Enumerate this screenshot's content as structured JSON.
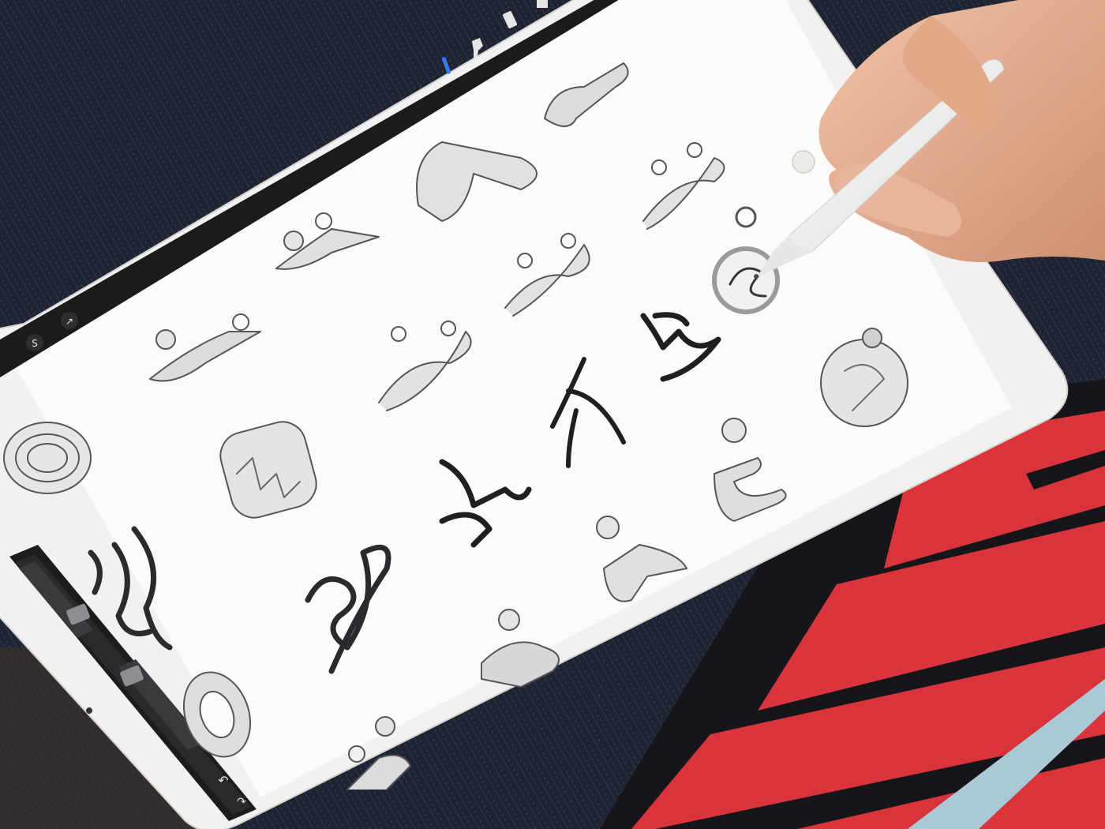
{
  "toolbar": {
    "left_buttons": [
      {
        "label": "S",
        "icon": "selection-icon"
      },
      {
        "label": "↗",
        "icon": "transform-arrow-icon"
      }
    ],
    "top_tools": [
      {
        "icon": "brush-icon",
        "active": true
      },
      {
        "icon": "smudge-icon",
        "active": false
      },
      {
        "icon": "eraser-icon",
        "active": false
      },
      {
        "icon": "layers-icon",
        "active": false
      }
    ],
    "undo_icon": "undo-icon",
    "redo_icon": "redo-icon",
    "active_tool_color": "#3478f6"
  },
  "sidebar": {
    "brush_size_slider": 0.25,
    "opacity_slider": 0.45
  },
  "colors": {
    "jeans": "#1f2433",
    "shirt_red": "#d9343c",
    "shirt_black": "#15151a",
    "shirt_stripe": "#a9c9d6",
    "ipad_bezel": "#f2f1ef",
    "canvas": "#fbfbfa",
    "skin": "#e7b497",
    "pencil": "#f5f5f3"
  }
}
